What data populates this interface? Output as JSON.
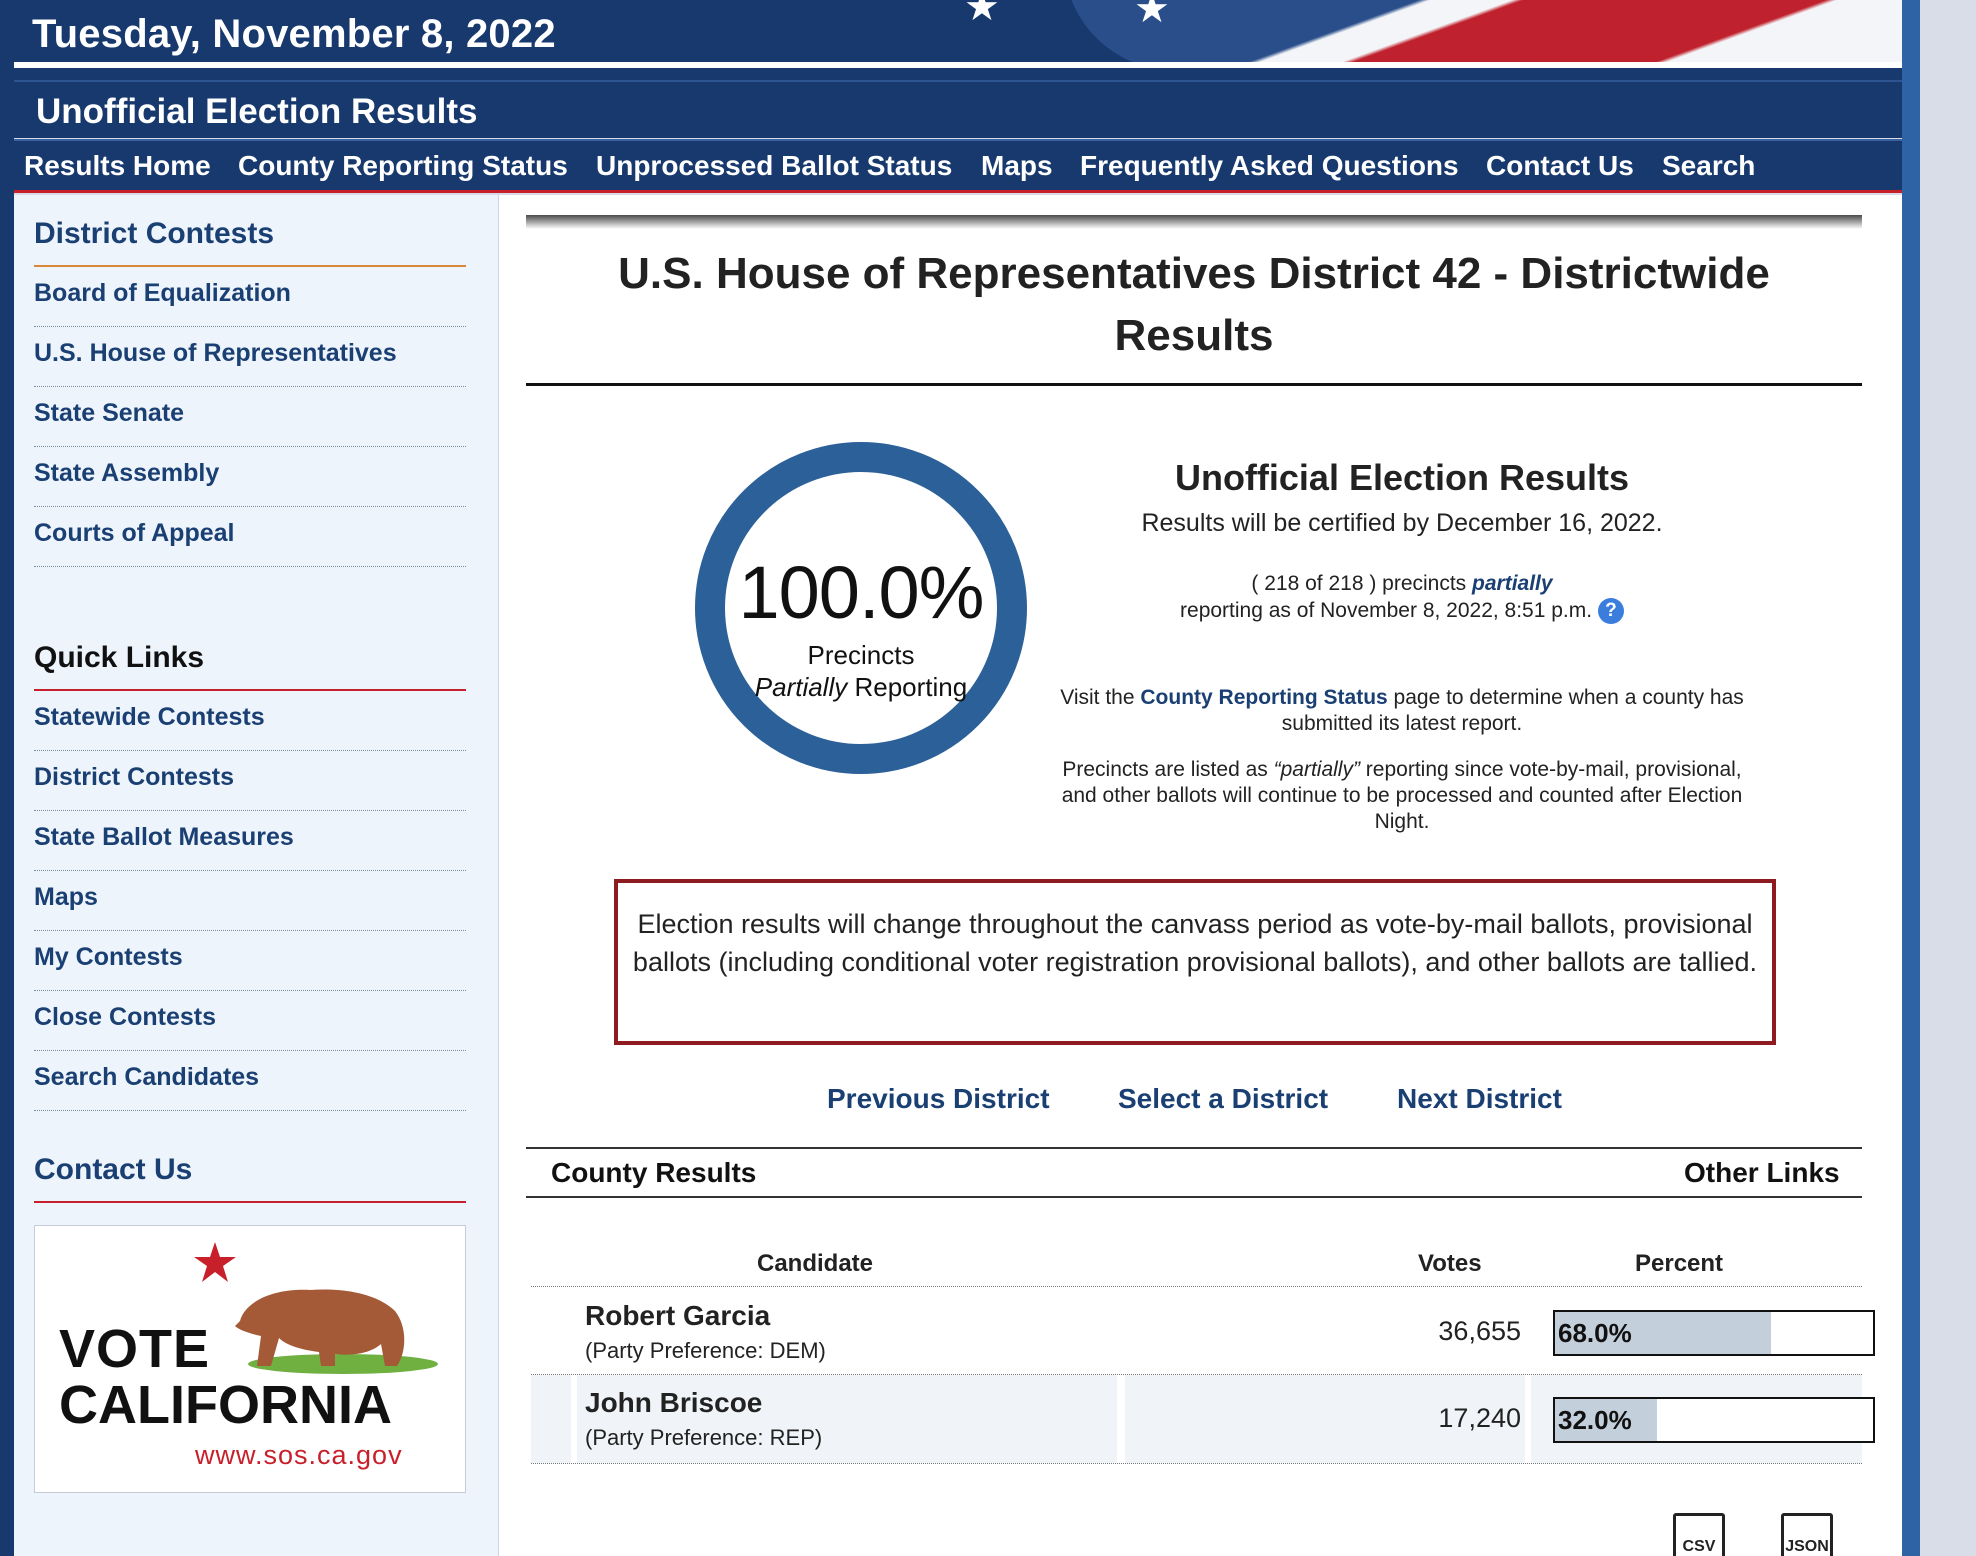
{
  "banner": {
    "date": "Tuesday, November 8, 2022"
  },
  "subhead": {
    "title": "Unofficial Election Results"
  },
  "nav": {
    "results_home": "Results Home",
    "county_reporting": "County Reporting Status",
    "unprocessed": "Unprocessed Ballot Status",
    "maps": "Maps",
    "faq": "Frequently Asked Questions",
    "contact": "Contact Us",
    "search": "Search"
  },
  "sidebar": {
    "district_contests_heading": "District Contests",
    "district_items": [
      "Board of Equalization",
      "U.S. House of Representatives",
      "State Senate",
      "State Assembly",
      "Courts of Appeal"
    ],
    "quick_links_heading": "Quick Links",
    "quick_items": [
      "Statewide Contests",
      "District Contests",
      "State Ballot Measures",
      "Maps",
      "My Contests",
      "Close Contests",
      "Search Candidates"
    ],
    "contact_heading": "Contact Us",
    "logo": {
      "line1": "VOTE",
      "line2": "CALIFORNIA",
      "url": "www.sos.ca.gov"
    }
  },
  "main": {
    "title_line1": "U.S. House of Representatives District 42 - Districtwide",
    "title_line2": "Results",
    "ring": {
      "percent": "100.0%",
      "label1": "Precincts",
      "label2_italic": "Partially",
      "label2_rest": " Reporting",
      "fraction": 1.0
    },
    "info": {
      "heading": "Unofficial Election Results",
      "certified": "Results will be certified by December 16, 2022.",
      "precincts_pre": "( 218 of 218 ) precincts ",
      "precincts_italic": "partially",
      "precincts_post": "reporting as of November 8, 2022, 8:51 p.m.",
      "help_glyph": "?",
      "visit_pre": "Visit the ",
      "visit_link": "County Reporting Status",
      "visit_post": " page to determine when a county has submitted its latest report.",
      "prov_pre": "Precincts are listed as ",
      "prov_italic": "“partially”",
      "prov_post": " reporting since vote-by-mail, provisional, and other ballots will continue to be processed and counted after Election Night."
    },
    "notice": "Election results will change throughout the canvass period as vote-by-mail ballots, provisional ballots (including conditional voter registration provisional ballots), and other ballots are tallied.",
    "district_nav": {
      "previous": "Previous District",
      "select": "Select a District",
      "next": "Next District"
    },
    "county_results": "County Results",
    "other_links": "Other Links",
    "table": {
      "headers": {
        "candidate": "Candidate",
        "votes": "Votes",
        "percent": "Percent"
      },
      "rows": [
        {
          "name": "Robert Garcia",
          "party": "(Party Preference: DEM)",
          "votes": "36,655",
          "percent": "68.0%",
          "share": 0.68
        },
        {
          "name": "John Briscoe",
          "party": "(Party Preference: REP)",
          "votes": "17,240",
          "percent": "32.0%",
          "share": 0.32
        }
      ]
    },
    "downloads": {
      "csv": "CSV",
      "json": "JSON"
    }
  },
  "colors": {
    "navy": "#17396e",
    "accent_red": "#c8202a",
    "link_blue": "#1a3f73",
    "ring_blue": "#2c6098",
    "notice_border": "#8e1b1f"
  }
}
